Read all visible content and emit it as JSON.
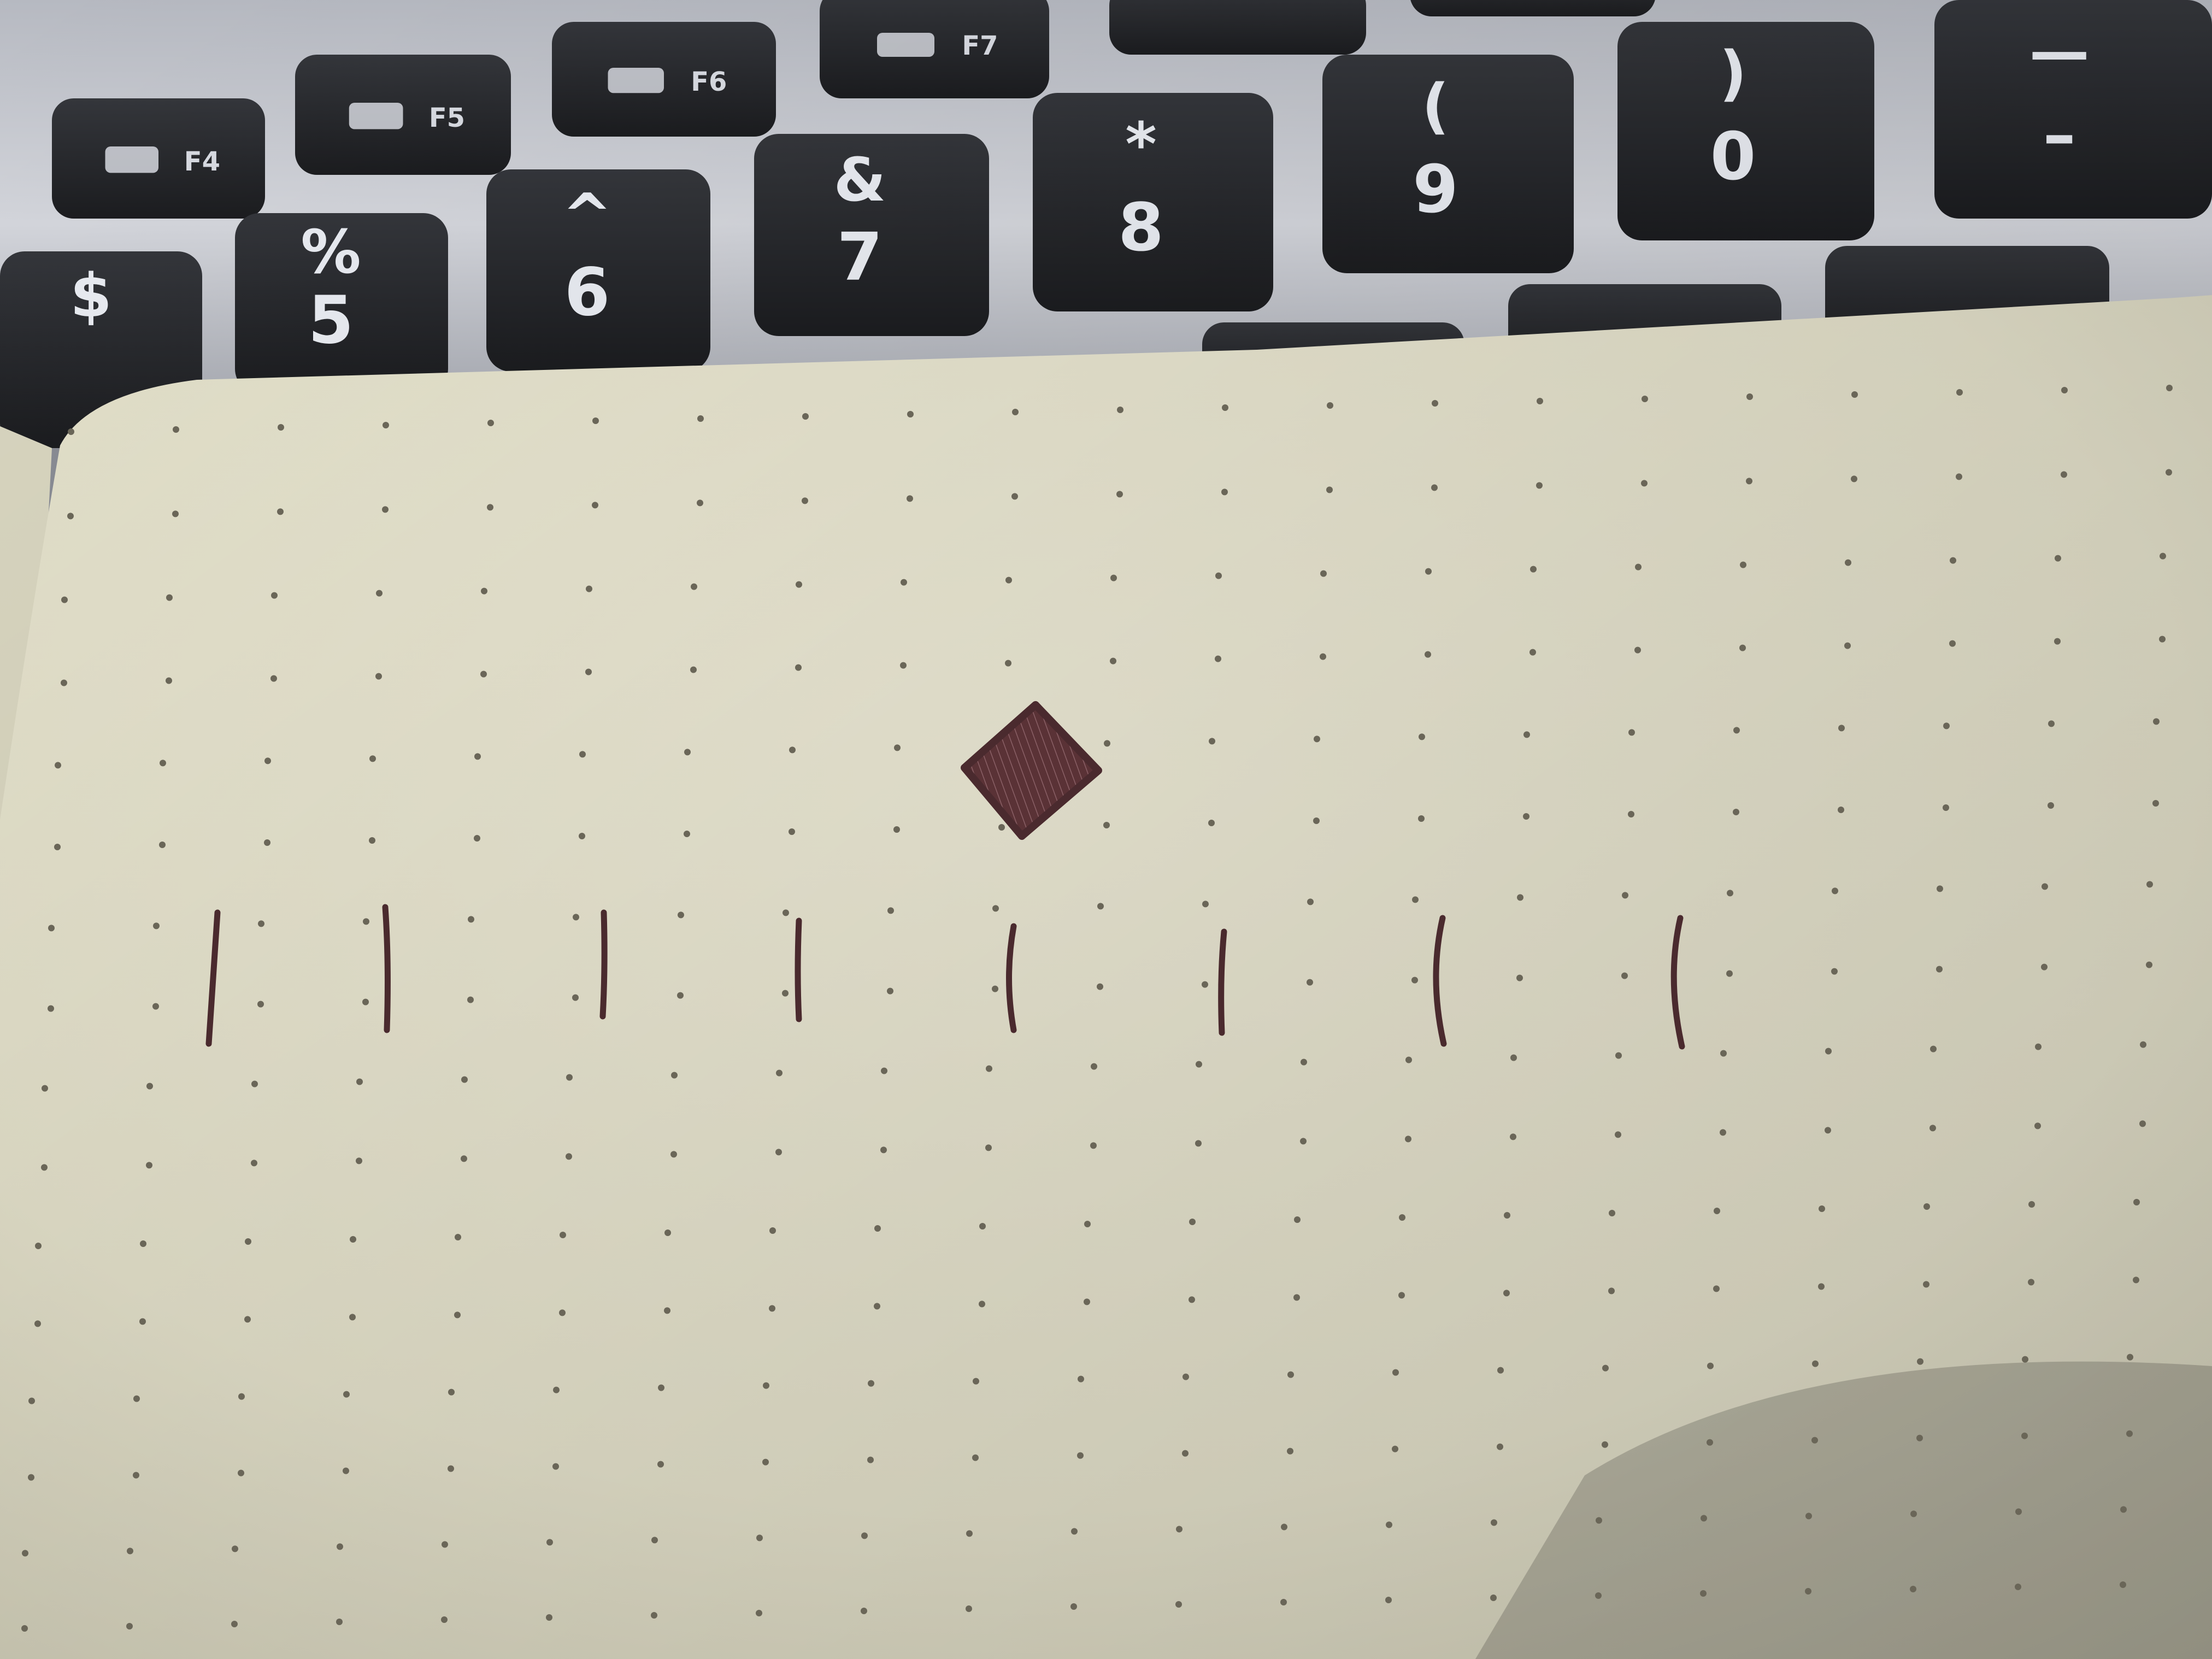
{
  "scene": {
    "keyboard": {
      "number_keys": [
        {
          "top": "$",
          "bottom": ""
        },
        {
          "top": "%",
          "bottom": "5"
        },
        {
          "top": "^",
          "bottom": "6"
        },
        {
          "top": "&",
          "bottom": "7"
        },
        {
          "top": "*",
          "bottom": "8"
        },
        {
          "top": "(",
          "bottom": "9"
        },
        {
          "top": ")",
          "bottom": "0"
        },
        {
          "top": "—",
          "bottom": "–"
        }
      ],
      "function_keys": [
        {
          "label": "F4",
          "icon": "launchpad-icon"
        },
        {
          "label": "F5",
          "icon": "keyboard-backlight-down-icon"
        },
        {
          "label": "F6",
          "icon": "keyboard-backlight-up-icon"
        },
        {
          "label": "F7",
          "icon": "rewind-icon"
        }
      ]
    },
    "notebook": {
      "type": "dot-grid",
      "drawing": {
        "diamond_count": 1,
        "stroke_count": 8,
        "ink_color": "#4a2a2e"
      }
    },
    "colors": {
      "key_cap": "#26282c",
      "keyboard_body": "#c9ccd3",
      "paper": "#e7e4cf",
      "paper_shadow": "#cfccb8",
      "dot": "#6a6658",
      "ink": "#4a2a2e"
    }
  }
}
